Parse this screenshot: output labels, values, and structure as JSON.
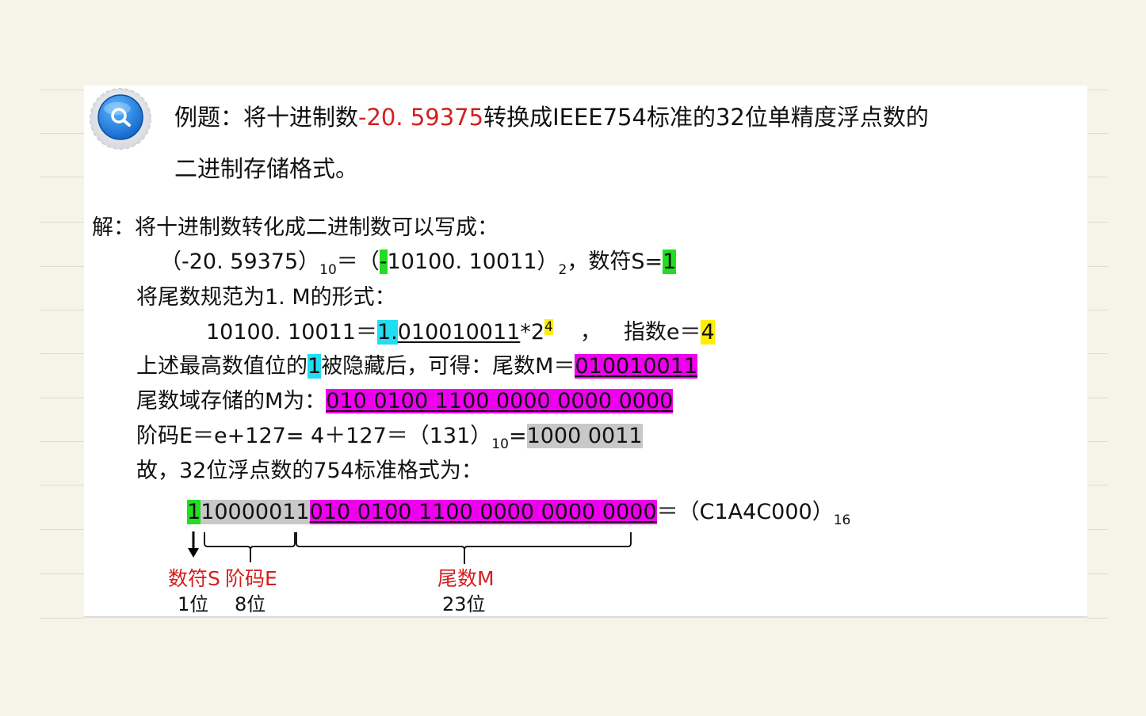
{
  "title": {
    "prefix": "例题：将十进制数",
    "number": "-20. 59375",
    "suffix": "转换成IEEE754标准的32位单精度浮点数的",
    "line2": "二进制存储格式。"
  },
  "solution": {
    "intro": "解：将十进制数转化成二进制数可以写成：",
    "line1": {
      "open": "（-20. 59375）",
      "base10": "10",
      "eq": "＝（",
      "sign": "-",
      "bin": "10100. 10011）",
      "base2": "2",
      "comma": "，",
      "sign_label": "数符S=",
      "sign_value": "1"
    },
    "normalize_label": "将尾数规范为1. M的形式：",
    "line2": {
      "left": "10100. 10011＝",
      "lead": "1.",
      "frac": "010010011",
      "mul": "*2",
      "exp": "4",
      "comma": "，",
      "exp_label": "指数e＝",
      "exp_value": "4"
    },
    "line3": {
      "pre": "上述最高数值位的",
      "one": "1",
      "post": "被隐藏后，可得：尾数M＝",
      "mantissa": "010010011"
    },
    "line4": {
      "label": "尾数域存储的M为：",
      "value": "010 0100 1100 0000 0000 0000"
    },
    "line5": {
      "label": "阶码E＝e+127= 4＋127＝（131）",
      "base": "10",
      "eq": "=",
      "value": "1000 0011"
    },
    "line6": "故，32位浮点数的754标准格式为：",
    "final": {
      "sign": "1",
      "exponent": "10000011",
      "mantissa": "010 0100 1100 0000 0000 0000",
      "eq": "＝（C1A4C000）",
      "base": "16"
    }
  },
  "labels": {
    "sign_name": "数符S",
    "sign_bits": "1位",
    "exp_name": "阶码E",
    "exp_bits": "8位",
    "mant_name": "尾数M",
    "mant_bits": "23位"
  },
  "icon": "search-icon"
}
